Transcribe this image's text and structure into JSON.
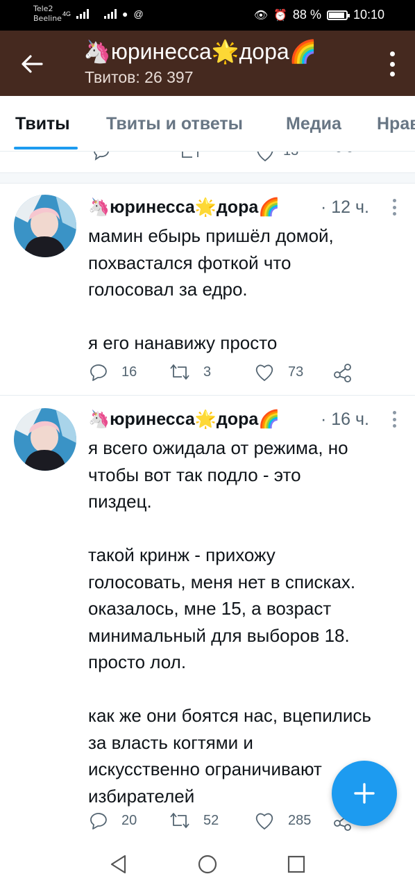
{
  "status_bar": {
    "carrier1": "Tele2",
    "carrier2": "Beeline",
    "network": "4G",
    "battery": "88 %",
    "time": "10:10"
  },
  "header": {
    "name": "🦄юринесса🌟дора🌈",
    "tweet_count": "Твитов: 26 397"
  },
  "tabs": [
    {
      "label": "Твиты",
      "active": true
    },
    {
      "label": "Твиты и ответы",
      "active": false
    },
    {
      "label": "Медиа",
      "active": false
    },
    {
      "label": "Нравится",
      "active": false
    }
  ],
  "previous_tweet_likes": "13",
  "tweets": [
    {
      "name": "🦄юринесса🌟дора🌈",
      "time": "· 12 ч.",
      "text": "мамин ебырь пришёл домой,\nпохвастался фоткой что\nголосовал за едро.\n\nя его нанавижу просто",
      "replies": "16",
      "retweets": "3",
      "likes": "73"
    },
    {
      "name": "🦄юринесса🌟дора🌈",
      "time": "· 16 ч.",
      "text": "я всего ожидала от режима, но\nчтобы вот так подло - это\nпиздец.\n\nтакой кринж - прихожу\nголосовать, меня нет в списках.\nоказалось, мне 15, а возраст\nминимальный для выборов 18.\nпросто лол.\n\nкак же они боятся нас, вцепились\nза власть когтями и\nискусственно ограничивают\nизбирателей",
      "replies": "20",
      "retweets": "52",
      "likes": "285"
    }
  ],
  "colors": {
    "header_bg": "#45291f",
    "accent": "#1d9bf0",
    "text": "#0f1419",
    "muted": "#536471"
  }
}
